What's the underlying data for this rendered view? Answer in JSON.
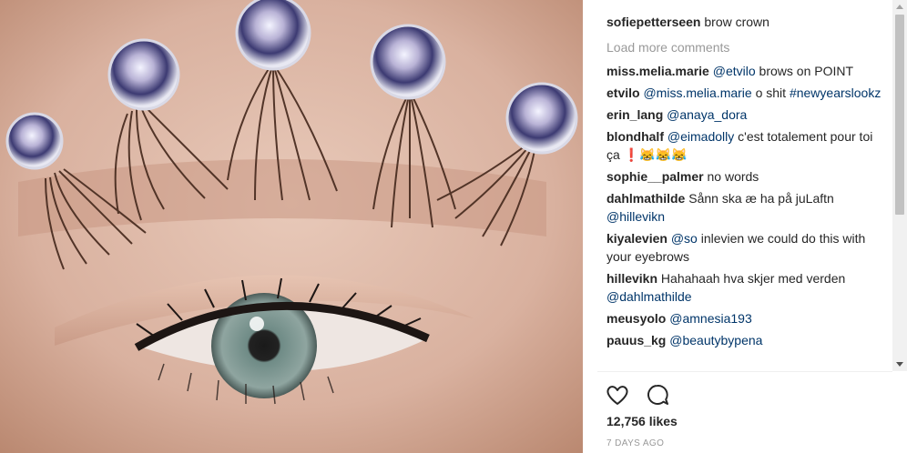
{
  "post": {
    "author": "sofiepetterseen",
    "caption": "brow crown",
    "load_more_label": "Load more comments",
    "likes": "12,756 likes",
    "timestamp": "7 DAYS AGO"
  },
  "comments": [
    {
      "user": "miss.melia.marie",
      "parts": [
        {
          "t": "@etvilo",
          "m": true
        },
        {
          "t": " brows on POINT"
        }
      ]
    },
    {
      "user": "etvilo",
      "parts": [
        {
          "t": "@miss.melia.marie",
          "m": true
        },
        {
          "t": " o shit "
        },
        {
          "t": "#newyearslookz",
          "m": true
        }
      ]
    },
    {
      "user": "erin_lang",
      "parts": [
        {
          "t": "@anaya_dora",
          "m": true
        }
      ]
    },
    {
      "user": "blondhalf",
      "parts": [
        {
          "t": "@eimadolly",
          "m": true
        },
        {
          "t": " c'est totalement pour toi ça ❗😹😹😹"
        }
      ]
    },
    {
      "user": "sophie__palmer",
      "parts": [
        {
          "t": "no words"
        }
      ]
    },
    {
      "user": "dahlmathilde",
      "parts": [
        {
          "t": "Sånn ska æ ha på juLaftn "
        },
        {
          "t": "@hillevikn",
          "m": true
        }
      ]
    },
    {
      "user": "kiyalevien",
      "parts": [
        {
          "t": "@so",
          "m": true
        },
        {
          "t": " inlevien we could do this with your eyebrows"
        }
      ]
    },
    {
      "user": "hillevikn",
      "parts": [
        {
          "t": "Hahahaah hva skjer med verden "
        },
        {
          "t": "@dahlmathilde",
          "m": true
        }
      ]
    },
    {
      "user": "meusyolo",
      "parts": [
        {
          "t": "@amnesia193",
          "m": true
        }
      ]
    },
    {
      "user": "pauus_kg",
      "parts": [
        {
          "t": "@beautybypena",
          "m": true
        }
      ]
    }
  ],
  "icons": {
    "like": "heart-icon",
    "comment": "comment-bubble-icon"
  },
  "colors": {
    "mention": "#003569",
    "muted": "#999999",
    "text": "#262626"
  }
}
